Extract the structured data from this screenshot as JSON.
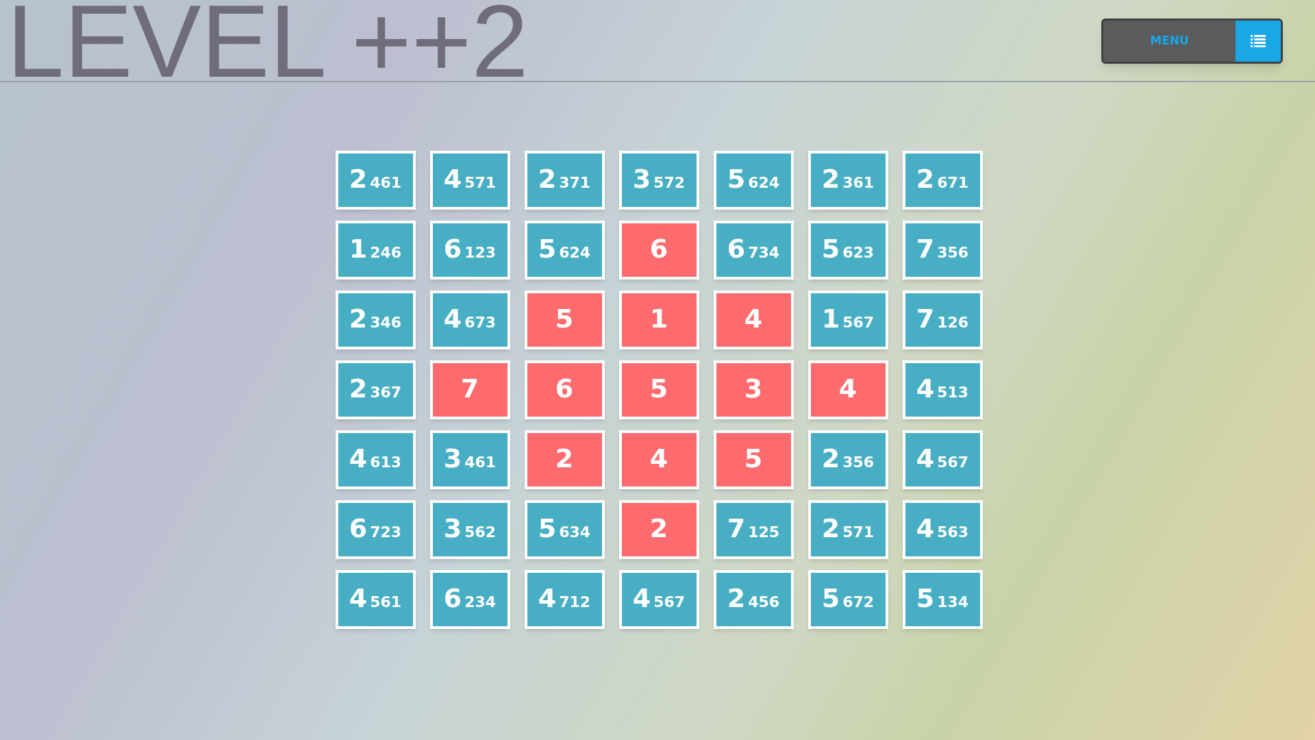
{
  "title": "LEVEL ++2",
  "menu": {
    "label": "MENU"
  },
  "grid": [
    [
      {
        "kind": "open",
        "value": "2",
        "candidates": "461"
      },
      {
        "kind": "open",
        "value": "4",
        "candidates": "571"
      },
      {
        "kind": "open",
        "value": "2",
        "candidates": "371"
      },
      {
        "kind": "open",
        "value": "3",
        "candidates": "572"
      },
      {
        "kind": "open",
        "value": "5",
        "candidates": "624"
      },
      {
        "kind": "open",
        "value": "2",
        "candidates": "361"
      },
      {
        "kind": "open",
        "value": "2",
        "candidates": "671"
      }
    ],
    [
      {
        "kind": "open",
        "value": "1",
        "candidates": "246"
      },
      {
        "kind": "open",
        "value": "6",
        "candidates": "123"
      },
      {
        "kind": "open",
        "value": "5",
        "candidates": "624"
      },
      {
        "kind": "solved",
        "value": "6"
      },
      {
        "kind": "open",
        "value": "6",
        "candidates": "734"
      },
      {
        "kind": "open",
        "value": "5",
        "candidates": "623"
      },
      {
        "kind": "open",
        "value": "7",
        "candidates": "356"
      }
    ],
    [
      {
        "kind": "open",
        "value": "2",
        "candidates": "346"
      },
      {
        "kind": "open",
        "value": "4",
        "candidates": "673"
      },
      {
        "kind": "solved",
        "value": "5"
      },
      {
        "kind": "solved",
        "value": "1"
      },
      {
        "kind": "solved",
        "value": "4"
      },
      {
        "kind": "open",
        "value": "1",
        "candidates": "567"
      },
      {
        "kind": "open",
        "value": "7",
        "candidates": "126"
      }
    ],
    [
      {
        "kind": "open",
        "value": "2",
        "candidates": "367"
      },
      {
        "kind": "solved",
        "value": "7"
      },
      {
        "kind": "solved",
        "value": "6"
      },
      {
        "kind": "solved",
        "value": "5"
      },
      {
        "kind": "solved",
        "value": "3"
      },
      {
        "kind": "solved",
        "value": "4"
      },
      {
        "kind": "open",
        "value": "4",
        "candidates": "513"
      }
    ],
    [
      {
        "kind": "open",
        "value": "4",
        "candidates": "613"
      },
      {
        "kind": "open",
        "value": "3",
        "candidates": "461"
      },
      {
        "kind": "solved",
        "value": "2"
      },
      {
        "kind": "solved",
        "value": "4"
      },
      {
        "kind": "solved",
        "value": "5"
      },
      {
        "kind": "open",
        "value": "2",
        "candidates": "356"
      },
      {
        "kind": "open",
        "value": "4",
        "candidates": "567"
      }
    ],
    [
      {
        "kind": "open",
        "value": "6",
        "candidates": "723"
      },
      {
        "kind": "open",
        "value": "3",
        "candidates": "562"
      },
      {
        "kind": "open",
        "value": "5",
        "candidates": "634"
      },
      {
        "kind": "solved",
        "value": "2"
      },
      {
        "kind": "open",
        "value": "7",
        "candidates": "125"
      },
      {
        "kind": "open",
        "value": "2",
        "candidates": "571"
      },
      {
        "kind": "open",
        "value": "4",
        "candidates": "563"
      }
    ],
    [
      {
        "kind": "open",
        "value": "4",
        "candidates": "561"
      },
      {
        "kind": "open",
        "value": "6",
        "candidates": "234"
      },
      {
        "kind": "open",
        "value": "4",
        "candidates": "712"
      },
      {
        "kind": "open",
        "value": "4",
        "candidates": "567"
      },
      {
        "kind": "open",
        "value": "2",
        "candidates": "456"
      },
      {
        "kind": "open",
        "value": "5",
        "candidates": "672"
      },
      {
        "kind": "open",
        "value": "5",
        "candidates": "134"
      }
    ]
  ]
}
